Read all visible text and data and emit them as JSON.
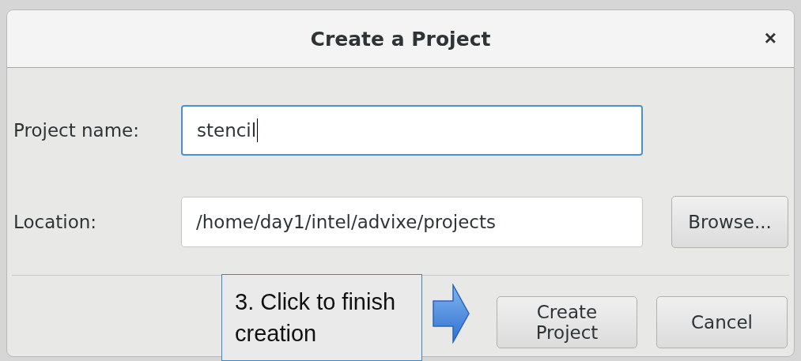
{
  "dialog": {
    "title": "Create a Project",
    "close": "×",
    "fields": [
      {
        "label": "Project name:",
        "value": "stencil",
        "focused": true
      },
      {
        "label": "Location:",
        "value": "/home/day1/intel/advixe/projects",
        "focused": false
      }
    ],
    "browse_button": "Browse...",
    "buttons": [
      "Create Project",
      "Cancel"
    ]
  },
  "callout": {
    "text": "3. Click to finish creation"
  }
}
